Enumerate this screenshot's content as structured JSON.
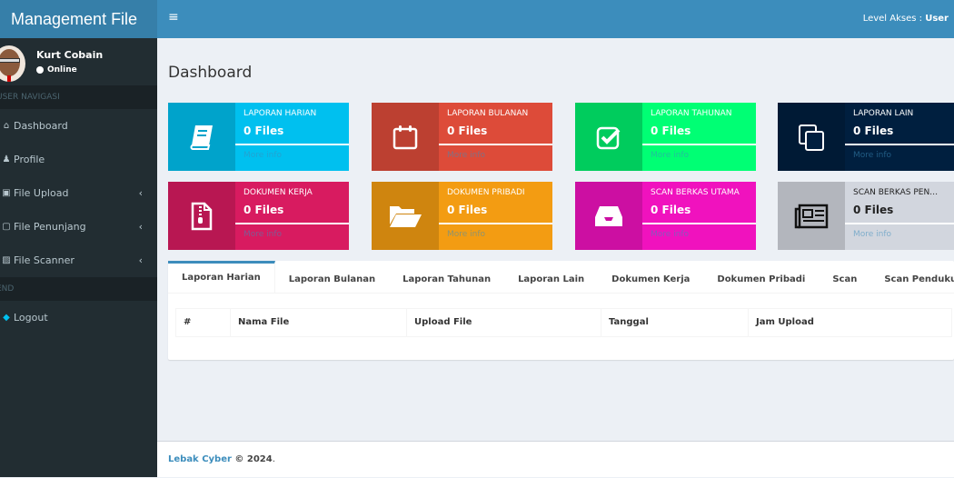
{
  "app": {
    "title": "Management File"
  },
  "user": {
    "name": "Kurt Cobain",
    "status": "Online"
  },
  "topbar": {
    "menu_icon": "hamburger-icon",
    "level_label": "Level Akses : ",
    "level_value": "User"
  },
  "sidebar": {
    "section1": "USER NAVIGASI",
    "items": [
      {
        "label": "Dashboard",
        "icon": "home-icon",
        "glyph": "⌂"
      },
      {
        "label": "Profile",
        "icon": "user-icon",
        "glyph": "♟"
      },
      {
        "label": "File Upload",
        "icon": "file-upload-icon",
        "glyph": "▣",
        "expandable": true
      },
      {
        "label": "File Penunjang",
        "icon": "folder-icon",
        "glyph": "▢",
        "expandable": true
      },
      {
        "label": "File Scanner",
        "icon": "image-icon",
        "glyph": "▨",
        "expandable": true
      }
    ],
    "section2": "END",
    "logout": {
      "label": "Logout",
      "icon": "logout-icon",
      "glyph": "◆"
    }
  },
  "page": {
    "title": "Dashboard"
  },
  "boxes": [
    {
      "label": "LAPORAN HARIAN",
      "value": "0 Files",
      "more": "More info",
      "icon": "book-icon",
      "color": "#00c0ef",
      "dark": "#00a3cb"
    },
    {
      "label": "LAPORAN BULANAN",
      "value": "0 Files",
      "more": "More info",
      "icon": "calendar-icon",
      "color": "#dd4b39",
      "dark": "#bc4031"
    },
    {
      "label": "LAPORAN TAHUNAN",
      "value": "0 Files",
      "more": "More info",
      "icon": "check-square-icon",
      "color": "#00ff74",
      "dark": "#00cc5d"
    },
    {
      "label": "LAPORAN LAIN",
      "value": "0 Files",
      "more": "More info",
      "icon": "copy-icon",
      "color": "#001f3f",
      "dark": "#001a35"
    },
    {
      "label": "DOKUMEN KERJA",
      "value": "0 Files",
      "more": "More info",
      "icon": "file-zip-icon",
      "color": "#d81b60",
      "dark": "#b81752"
    },
    {
      "label": "DOKUMEN PRIBADI",
      "value": "0 Files",
      "more": "More info",
      "icon": "folder-open-icon",
      "color": "#f39c12",
      "dark": "#cf850f"
    },
    {
      "label": "SCAN BERKAS UTAMA",
      "value": "0 Files",
      "more": "More info",
      "icon": "inbox-icon",
      "color": "#f012be",
      "dark": "#cc0fa2"
    },
    {
      "label": "SCAN BERKAS PEN…",
      "value": "0 Files",
      "more": "More info",
      "icon": "newspaper-icon",
      "color": "#d2d6de",
      "dark": "#b3b6bd"
    }
  ],
  "tabs": [
    "Laporan Harian",
    "Laporan Bulanan",
    "Laporan Tahunan",
    "Laporan Lain",
    "Dokumen Kerja",
    "Dokumen Pribadi",
    "Scan",
    "Scan Pendukung"
  ],
  "active_tab": 0,
  "table": {
    "columns": [
      "#",
      "Nama File",
      "Upload File",
      "Tanggal",
      "Jam Upload"
    ],
    "rows": []
  },
  "footer": {
    "brand": "Lebak Cyber",
    "copy": " © 2024",
    "end": "."
  }
}
